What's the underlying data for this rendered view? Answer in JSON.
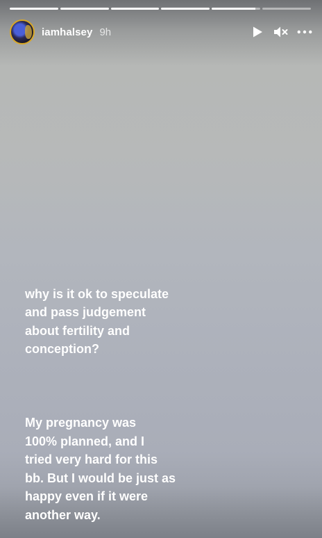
{
  "story": {
    "progress_segments": [
      {
        "fill": 1.0
      },
      {
        "fill": 1.0
      },
      {
        "fill": 1.0
      },
      {
        "fill": 1.0
      },
      {
        "fill": 0.9
      },
      {
        "fill": 0.0
      }
    ]
  },
  "header": {
    "username": "iamhalsey",
    "time": "9h",
    "icons": {
      "play": "play-icon",
      "mute": "mute-icon",
      "more": "more-icon"
    }
  },
  "caption": {
    "paragraph1": "why is it ok to speculate\nand pass judgement\nabout fertility and\nconception?",
    "paragraph2": "My pregnancy was\n100% planned, and I\ntried very hard for this\nbb. But I would be just as\nhappy even if it were\nanother way."
  }
}
